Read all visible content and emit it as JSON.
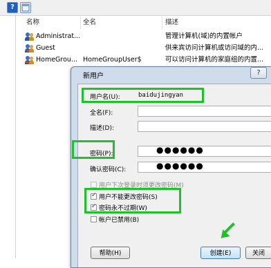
{
  "toolbar": {
    "help_icon": "?"
  },
  "list": {
    "columns": [
      "名称",
      "全名",
      "描述"
    ],
    "rows": [
      {
        "name": "Administrat...",
        "fullname": "",
        "description": "管理计算机(域)的内置帐户"
      },
      {
        "name": "Guest",
        "fullname": "",
        "description": "供来宾访问计算机或访问域的内..."
      },
      {
        "name": "HomeGrou...",
        "fullname": "HomeGroupUser$",
        "description": "可以访问计算机的家庭组的内置..."
      }
    ]
  },
  "dialog": {
    "title": "新用户",
    "help_button": "?",
    "username_label": "用户名(U):",
    "username_value": "baidujingyan",
    "fullname_label": "全名(F):",
    "fullname_value": "",
    "description_label": "描述(D):",
    "description_value": "",
    "password_label": "密码(P):",
    "password_value": "●●●●●●",
    "confirm_label": "确认密码(C):",
    "confirm_value": "●●●●●●",
    "options": [
      {
        "label": "用户下次登录时须更改密码(M)",
        "checked": false,
        "disabled": true
      },
      {
        "label": "用户不能更改密码(S)",
        "checked": true,
        "disabled": false
      },
      {
        "label": "密码永不过期(W)",
        "checked": true,
        "disabled": false
      },
      {
        "label": "帐户已禁用(B)",
        "checked": false,
        "disabled": false
      }
    ],
    "buttons": {
      "help": "帮助(H)",
      "create": "创建(E)",
      "close": "关闭"
    }
  },
  "colors": {
    "highlight": "#1fbf2e",
    "dialog_frame": "#cfdcec"
  }
}
